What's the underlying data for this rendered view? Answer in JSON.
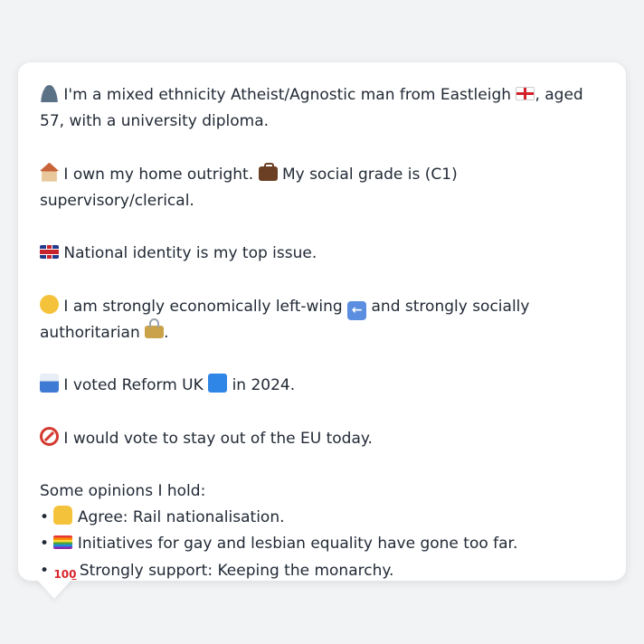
{
  "profile": {
    "line1_pre": "I'm a mixed ethnicity Atheist/Agnostic man from Eastleigh",
    "line1_post": ", aged 57, with a university diploma.",
    "home_text": "I own my home outright.",
    "grade_text": "My social grade is (C1) supervisory/clerical.",
    "issue_text": "National identity is my top issue.",
    "econ_pre": "I am strongly economically left-wing",
    "econ_mid": "and strongly socially authoritarian",
    "econ_end": ".",
    "vote_pre": "I voted Reform UK",
    "vote_post": "in 2024.",
    "eu_text": "I would vote to stay out of the EU today.",
    "opinions_heading": "Some opinions I hold:",
    "bullet": "•",
    "opinions": [
      "Agree: Rail nationalisation.",
      "Initiatives for gay and lesbian equality have gone too far.",
      "Strongly support: Keeping the monarchy."
    ]
  },
  "icons": {
    "person": "bust-in-silhouette-icon",
    "england_flag": "england-flag-icon",
    "house": "house-icon",
    "briefcase": "briefcase-icon",
    "uk_flag": "uk-flag-icon",
    "thinking": "thinking-face-icon",
    "left_arrow": "left-arrow-icon",
    "lock": "lock-icon",
    "ballot": "ballot-box-icon",
    "blue_square": "blue-square-icon",
    "no_entry": "no-entry-icon",
    "thumbs_up": "thumbs-up-icon",
    "rainbow_flag": "rainbow-flag-icon",
    "hundred": "hundred-points-icon"
  },
  "colors": {
    "background": "#f1f3f5",
    "card": "#ffffff",
    "text": "#222a36"
  }
}
